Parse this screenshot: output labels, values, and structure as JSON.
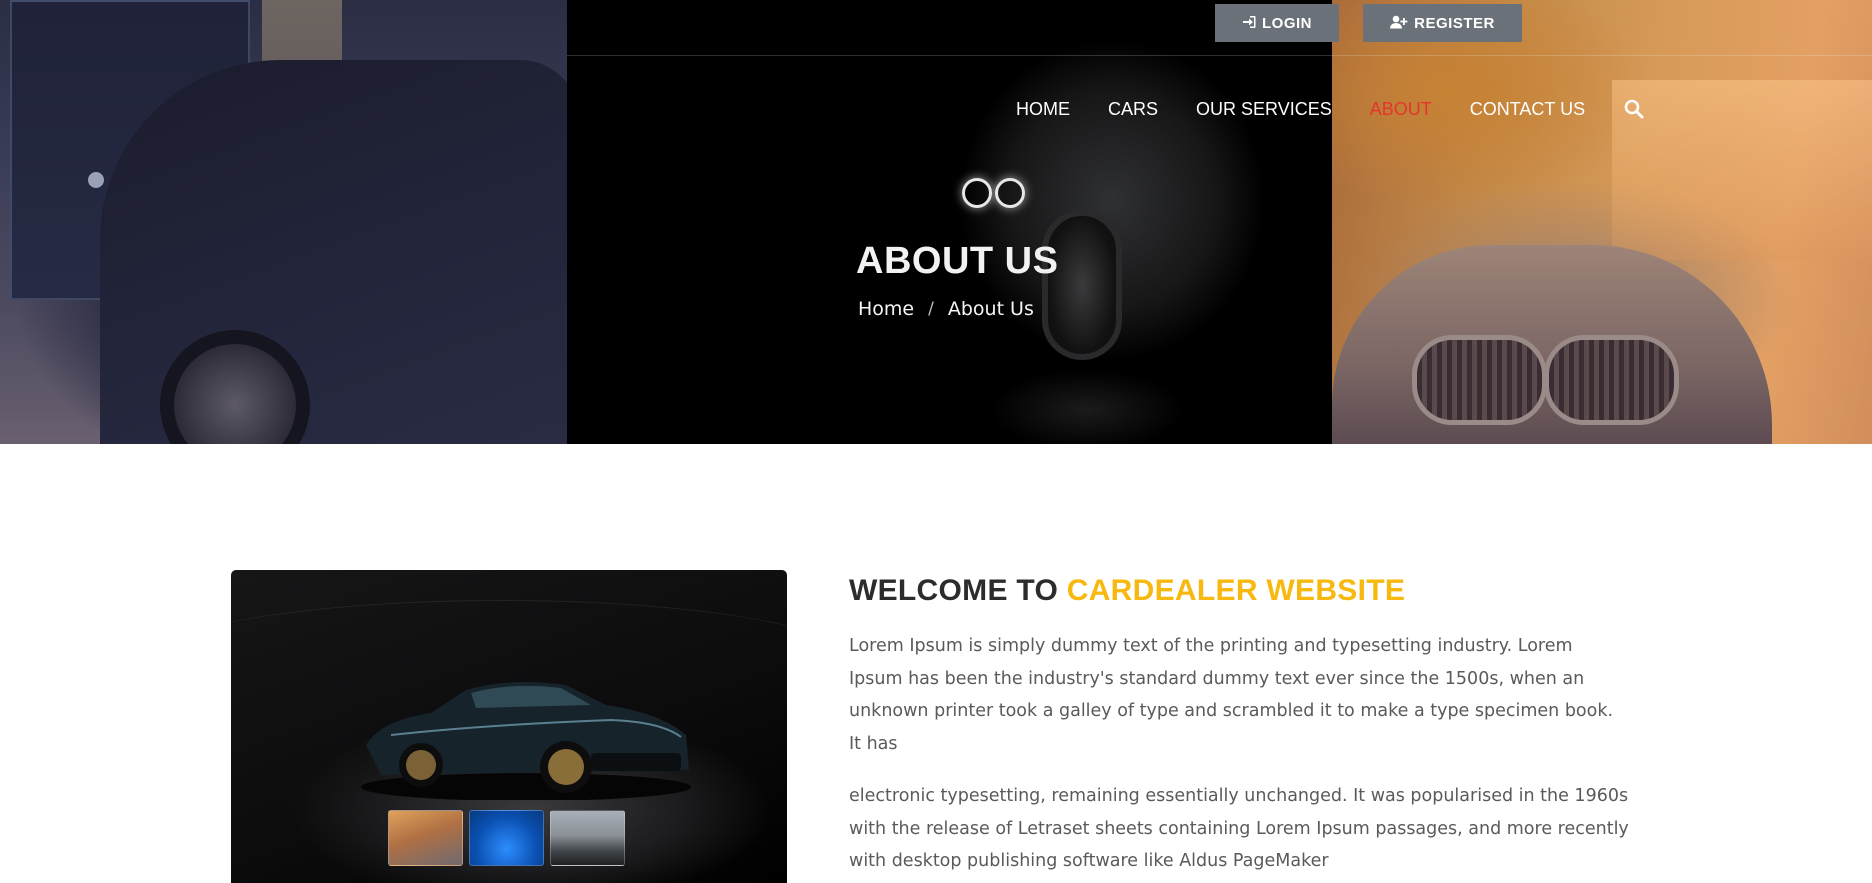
{
  "topbar": {
    "login_label": "LOGIN",
    "register_label": "REGISTER"
  },
  "nav": {
    "items": [
      {
        "label": "HOME",
        "active": false
      },
      {
        "label": "CARS",
        "active": false
      },
      {
        "label": "OUR SERVICES",
        "active": false
      },
      {
        "label": "ABOUT",
        "active": true
      },
      {
        "label": "CONTACT US",
        "active": false
      }
    ],
    "search_icon": "search-icon"
  },
  "hero": {
    "title": "ABOUT US",
    "breadcrumb": {
      "home": "Home",
      "separator": "/",
      "current": "About Us"
    }
  },
  "welcome": {
    "title_prefix": "WELCOME TO ",
    "title_accent": "CARDEALER WEBSITE",
    "paragraph_1": "Lorem Ipsum is simply dummy text of the printing and typesetting industry. Lorem Ipsum has been the industry's standard dummy text ever since the 1500s, when an unknown printer took a galley of type and scrambled it to make a type specimen book. It has",
    "paragraph_2": "electronic typesetting, remaining essentially unchanged. It was popularised in the 1960s with the release of Letraset sheets containing Lorem Ipsum passages, and more recently with desktop publishing software like Aldus PageMaker"
  },
  "gallery": {
    "thumbnails": [
      "car-photo-sunset",
      "car-photo-blue",
      "car-photo-garage"
    ]
  },
  "colors": {
    "accent_yellow": "#f7b90f",
    "nav_active_red": "#e5352b",
    "button_gray": "#6b7178",
    "heading_dark": "#2c2c2c",
    "body_text": "#5a5a5a"
  }
}
